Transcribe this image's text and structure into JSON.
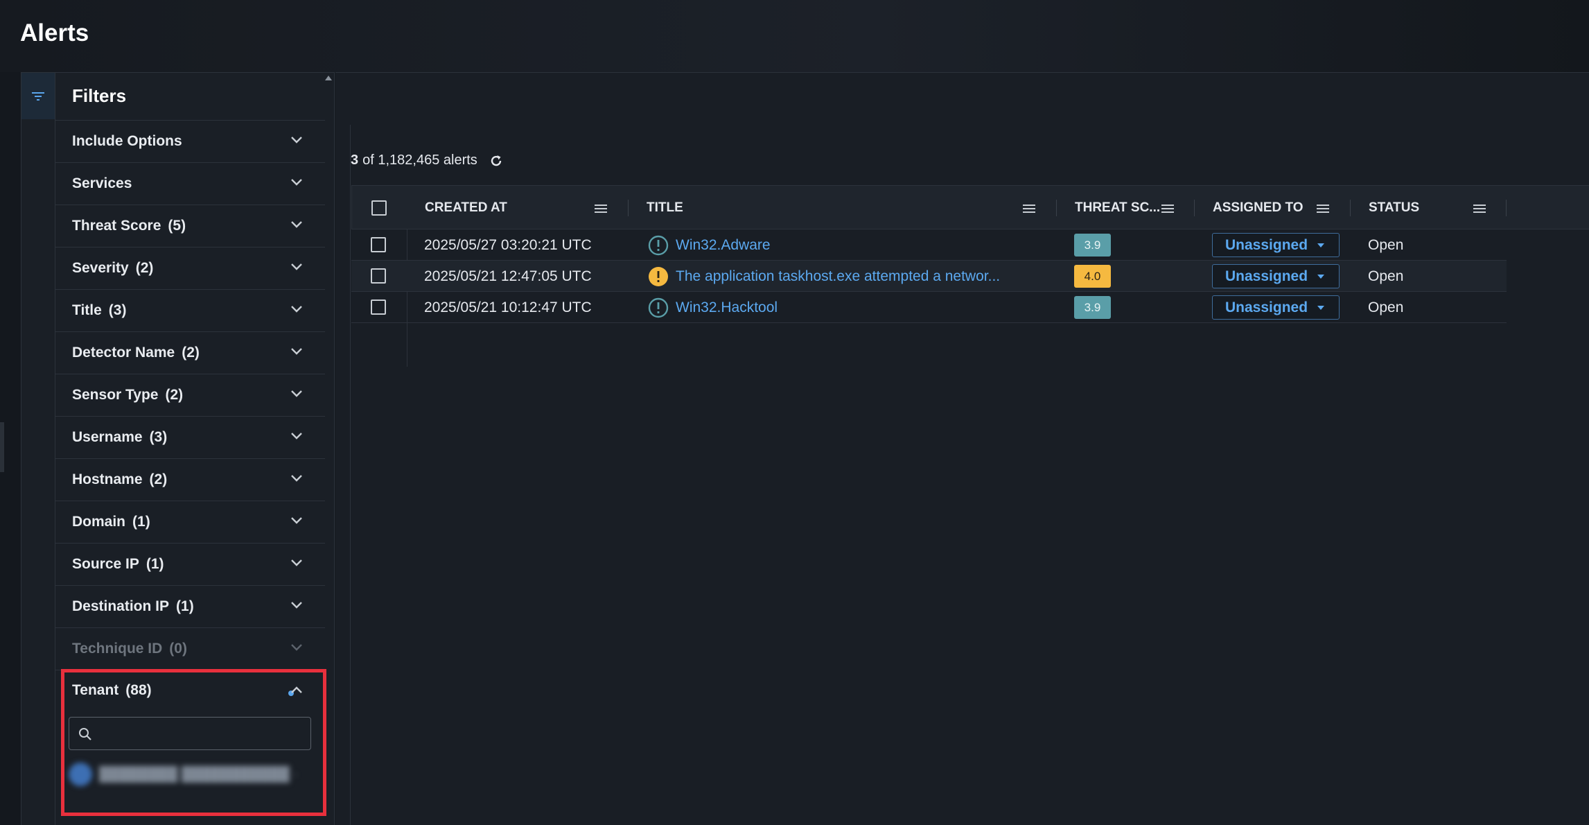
{
  "page": {
    "title": "Alerts"
  },
  "filters": {
    "title": "Filters",
    "items": [
      {
        "label": "Include Options",
        "count": ""
      },
      {
        "label": "Services",
        "count": ""
      },
      {
        "label": "Threat Score",
        "count": "(5)"
      },
      {
        "label": "Severity",
        "count": "(2)"
      },
      {
        "label": "Title",
        "count": "(3)"
      },
      {
        "label": "Detector Name",
        "count": "(2)"
      },
      {
        "label": "Sensor Type",
        "count": "(2)"
      },
      {
        "label": "Username",
        "count": "(3)"
      },
      {
        "label": "Hostname",
        "count": "(2)"
      },
      {
        "label": "Domain",
        "count": "(1)"
      },
      {
        "label": "Source IP",
        "count": "(1)"
      },
      {
        "label": "Destination IP",
        "count": "(1)"
      },
      {
        "label": "Technique ID",
        "count": "(0)"
      }
    ],
    "tenant": {
      "label": "Tenant",
      "count": "(88)",
      "search_value": ""
    }
  },
  "results": {
    "shown": "3",
    "text": "of 1,182,465 alerts"
  },
  "table": {
    "columns": [
      "CREATED AT",
      "TITLE",
      "THREAT SC...",
      "ASSIGNED TO",
      "STATUS"
    ],
    "rows": [
      {
        "created_at": "2025/05/27 03:20:21 UTC",
        "title": "Win32.Adware",
        "severity_icon": "info-circle-icon",
        "threat_score": "3.9",
        "assigned_to": "Unassigned",
        "status": "Open"
      },
      {
        "created_at": "2025/05/21 12:47:05 UTC",
        "title": "The application taskhost.exe attempted a networ...",
        "severity_icon": "warning-circle-icon",
        "threat_score": "4.0",
        "assigned_to": "Unassigned",
        "status": "Open"
      },
      {
        "created_at": "2025/05/21 10:12:47 UTC",
        "title": "Win32.Hacktool",
        "severity_icon": "info-circle-icon",
        "threat_score": "3.9",
        "assigned_to": "Unassigned",
        "status": "Open"
      }
    ]
  },
  "colors": {
    "link": "#5ca9f0",
    "badge_teal": "#5a9ea8",
    "badge_amber": "#f5b940",
    "highlight": "#e8303d"
  }
}
